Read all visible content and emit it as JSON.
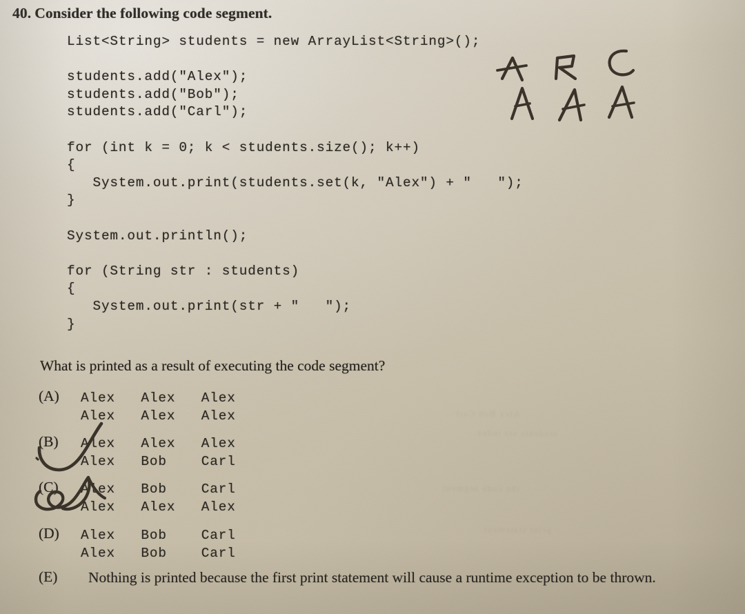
{
  "question": {
    "number": "40.",
    "stem": "Consider the following code segment.",
    "prompt": "What is printed as a result of executing the code segment?"
  },
  "code": {
    "lines": [
      "List<String> students = new ArrayList<String>();",
      "",
      "students.add(\"Alex\");",
      "students.add(\"Bob\");",
      "students.add(\"Carl\");",
      "",
      "for (int k = 0; k < students.size(); k++)",
      "{",
      "   System.out.print(students.set(k, \"Alex\") + \"   \");",
      "}",
      "",
      "System.out.println();",
      "",
      "for (String str : students)",
      "{",
      "   System.out.print(str + \"   \");",
      "}"
    ]
  },
  "choices": [
    {
      "letter": "(A)",
      "kind": "mono",
      "lines": [
        "Alex   Alex   Alex",
        "Alex   Alex   Alex"
      ],
      "mark": "none"
    },
    {
      "letter": "(B)",
      "kind": "mono",
      "lines": [
        "Alex   Alex   Alex",
        "Alex   Bob    Carl"
      ],
      "mark": "check"
    },
    {
      "letter": "(C)",
      "kind": "mono",
      "lines": [
        "Alex   Bob    Carl",
        "Alex   Alex   Alex"
      ],
      "mark": "scribble"
    },
    {
      "letter": "(D)",
      "kind": "mono",
      "lines": [
        "Alex   Bob    Carl",
        "Alex   Bob    Carl"
      ],
      "mark": "none"
    },
    {
      "letter": "(E)",
      "kind": "serif",
      "text": "Nothing is printed because the first print statement will cause a runtime exception to be thrown.",
      "mark": "none"
    }
  ],
  "annotations": {
    "scratch_work": {
      "top_row": [
        "A",
        "B",
        "C"
      ],
      "bottom_row": [
        "A",
        "A",
        "A"
      ]
    },
    "selected_choice": "(B)",
    "crossed_out_choice": "(C)"
  },
  "showthrough_ghost_text": [
    "Alex Bob Carl",
    "students set index",
    "the code segment",
    "print statement"
  ],
  "colors": {
    "paper": "#c9c0ac",
    "paper_light": "#d8d4cc",
    "print_ink": "#2a2722",
    "pen_ink": "#3a332a"
  }
}
